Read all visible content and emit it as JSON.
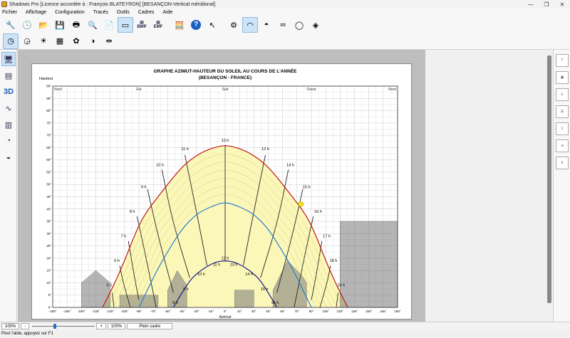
{
  "window": {
    "title": "Shadows Pro  [Licence accordée à :  François BLATEYRON]  [BESANÇON-Vertical méridional]",
    "minimize": "—",
    "restore": "❐",
    "close": "✕"
  },
  "menu": [
    "Fichier",
    "Affichage",
    "Configuration",
    "Tracés",
    "Outils",
    "Cadres",
    "Aide"
  ],
  "toolbar1": {
    "bmp_label": "BMP",
    "emf_label": "EMF"
  },
  "chart_data": {
    "type": "line",
    "title": "GRAPHE AZIMUT-HAUTEUR DU SOLEIL AU COURS DE L'ANNÉE",
    "subtitle": "(BESANÇON - FRANCE)",
    "ylabel": "Hauteur",
    "xlabel": "Azimut",
    "xlim": [
      -180,
      180
    ],
    "ylim": [
      0,
      90
    ],
    "x_ticks": [
      "-180°",
      "-165°",
      "-150°",
      "-135°",
      "-120°",
      "-105°",
      "-90°",
      "-75°",
      "-60°",
      "-45°",
      "-30°",
      "-15°",
      "0°",
      "15°",
      "30°",
      "45°",
      "60°",
      "75°",
      "90°",
      "105°",
      "120°",
      "135°",
      "150°",
      "165°",
      "180°"
    ],
    "y_ticks": [
      "0°",
      "5°",
      "10°",
      "15°",
      "20°",
      "25°",
      "30°",
      "35°",
      "40°",
      "45°",
      "50°",
      "55°",
      "60°",
      "65°",
      "70°",
      "75°",
      "80°",
      "85°",
      "90°"
    ],
    "directions": [
      {
        "label": "Nord",
        "az": -180
      },
      {
        "label": "Est",
        "az": -90
      },
      {
        "label": "Sud",
        "az": 0
      },
      {
        "label": "Ouest",
        "az": 90
      },
      {
        "label": "Nord",
        "az": 180
      }
    ],
    "grid": true,
    "series": [
      {
        "key": "summer",
        "color": "#c01818",
        "points": [
          [
            -128,
            0
          ],
          [
            -115,
            10
          ],
          [
            -104,
            20
          ],
          [
            -96,
            28
          ],
          [
            -88,
            35
          ],
          [
            -80,
            40
          ],
          [
            -72,
            44
          ],
          [
            -62,
            49
          ],
          [
            -52,
            54
          ],
          [
            -40,
            59
          ],
          [
            -25,
            63
          ],
          [
            -12,
            65
          ],
          [
            0,
            66
          ],
          [
            12,
            65
          ],
          [
            25,
            63
          ],
          [
            40,
            59
          ],
          [
            52,
            54
          ],
          [
            62,
            49
          ],
          [
            72,
            44
          ],
          [
            80,
            40
          ],
          [
            88,
            35
          ],
          [
            96,
            28
          ],
          [
            104,
            20
          ],
          [
            115,
            10
          ],
          [
            128,
            0
          ]
        ]
      },
      {
        "key": "equinox",
        "color": "#2a7cd0",
        "points": [
          [
            -90,
            0
          ],
          [
            -80,
            8
          ],
          [
            -70,
            16
          ],
          [
            -58,
            24
          ],
          [
            -45,
            32
          ],
          [
            -30,
            38
          ],
          [
            -15,
            41
          ],
          [
            0,
            43
          ],
          [
            15,
            41
          ],
          [
            30,
            38
          ],
          [
            45,
            32
          ],
          [
            58,
            24
          ],
          [
            70,
            16
          ],
          [
            80,
            8
          ],
          [
            90,
            0
          ]
        ]
      },
      {
        "key": "winter",
        "color": "#1a1a8a",
        "points": [
          [
            -54,
            0
          ],
          [
            -45,
            6
          ],
          [
            -35,
            12
          ],
          [
            -22,
            16
          ],
          [
            -10,
            18.5
          ],
          [
            0,
            19
          ],
          [
            10,
            18.5
          ],
          [
            22,
            16
          ],
          [
            35,
            12
          ],
          [
            45,
            6
          ],
          [
            54,
            0
          ]
        ]
      }
    ],
    "hour_lines": [
      {
        "label": "5 h",
        "points": [
          [
            -116,
            0
          ],
          [
            -118,
            6
          ]
        ]
      },
      {
        "label": "6 h",
        "points": [
          [
            -99,
            0
          ],
          [
            -107,
            11
          ],
          [
            -110,
            17
          ]
        ]
      },
      {
        "label": "7 h",
        "points": [
          [
            -90,
            3
          ],
          [
            -95,
            13
          ],
          [
            -101,
            27
          ]
        ]
      },
      {
        "label": "8 h",
        "points": [
          [
            -72,
            0
          ],
          [
            -83,
            21
          ],
          [
            -92,
            37
          ]
        ]
      },
      {
        "label": "9 h",
        "points": [
          [
            -54,
            6
          ],
          [
            -70,
            29
          ],
          [
            -81,
            48
          ]
        ]
      },
      {
        "label": "10 h",
        "points": [
          [
            -37,
            12
          ],
          [
            -55,
            35
          ],
          [
            -66,
            56
          ]
        ]
      },
      {
        "label": "11 h",
        "points": [
          [
            -19,
            17
          ],
          [
            -30,
            39
          ],
          [
            -42,
            62
          ]
        ]
      },
      {
        "label": "12 h",
        "points": [
          [
            0,
            19
          ],
          [
            0,
            43
          ],
          [
            0,
            66
          ]
        ]
      },
      {
        "label": "13 h",
        "points": [
          [
            19,
            17
          ],
          [
            30,
            39
          ],
          [
            42,
            62
          ]
        ]
      },
      {
        "label": "14 h",
        "points": [
          [
            37,
            12
          ],
          [
            55,
            35
          ],
          [
            66,
            56
          ]
        ]
      },
      {
        "label": "15 h",
        "points": [
          [
            54,
            6
          ],
          [
            70,
            29
          ],
          [
            81,
            48
          ]
        ]
      },
      {
        "label": "16 h",
        "points": [
          [
            72,
            0
          ],
          [
            83,
            21
          ],
          [
            92,
            37
          ]
        ]
      },
      {
        "label": "17 h",
        "points": [
          [
            90,
            3
          ],
          [
            95,
            13
          ],
          [
            101,
            27
          ]
        ]
      },
      {
        "label": "18 h",
        "points": [
          [
            99,
            0
          ],
          [
            107,
            11
          ],
          [
            110,
            17
          ]
        ]
      },
      {
        "label": "19 h",
        "points": [
          [
            116,
            0
          ],
          [
            118,
            6
          ]
        ]
      }
    ],
    "hour_labels": [
      {
        "text": "5 h",
        "az": -121,
        "alt": 8.5
      },
      {
        "text": "6 h",
        "az": -113,
        "alt": 18.5
      },
      {
        "text": "7 h",
        "az": -106,
        "alt": 28.5
      },
      {
        "text": "8 h",
        "az": -97,
        "alt": 38.5
      },
      {
        "text": "9 h",
        "az": -85,
        "alt": 48.5
      },
      {
        "text": "10 h",
        "az": -68,
        "alt": 57.5
      },
      {
        "text": "11 h",
        "az": -42,
        "alt": 64
      },
      {
        "text": "12 h",
        "az": 0,
        "alt": 67.5
      },
      {
        "text": "13 h",
        "az": 42,
        "alt": 64
      },
      {
        "text": "14 h",
        "az": 68,
        "alt": 57.5
      },
      {
        "text": "15 h",
        "az": 85,
        "alt": 48.5
      },
      {
        "text": "16 h",
        "az": 97,
        "alt": 38.5
      },
      {
        "text": "17 h",
        "az": 106,
        "alt": 28.5
      },
      {
        "text": "18 h",
        "az": 113,
        "alt": 18.5
      },
      {
        "text": "19 h",
        "az": 121,
        "alt": 8.5
      },
      {
        "text": "9 h",
        "az": -41,
        "alt": 7
      },
      {
        "text": "10 h",
        "az": -25,
        "alt": 13
      },
      {
        "text": "11 h",
        "az": -9,
        "alt": 17
      },
      {
        "text": "12 h",
        "az": 0,
        "alt": 19.5
      },
      {
        "text": "13 h",
        "az": 9,
        "alt": 17
      },
      {
        "text": "14 h",
        "az": 25,
        "alt": 13
      },
      {
        "text": "15 h",
        "az": 41,
        "alt": 7
      },
      {
        "text": "8 h",
        "az": -52,
        "alt": 1.5
      },
      {
        "text": "16 h",
        "az": 52,
        "alt": 1.5
      }
    ],
    "sun_marker": {
      "az": 79,
      "alt": 42,
      "color": "#f0e020"
    },
    "obstacles": [
      {
        "points": [
          [
            -150,
            10
          ],
          [
            -135,
            15
          ],
          [
            -120,
            10
          ],
          [
            -120,
            0
          ],
          [
            -150,
            0
          ]
        ]
      },
      {
        "points": [
          [
            -110,
            0
          ],
          [
            -110,
            5
          ],
          [
            -70,
            5
          ],
          [
            -70,
            0
          ]
        ]
      },
      {
        "points": [
          [
            -60,
            0
          ],
          [
            -60,
            7
          ],
          [
            -50,
            15
          ],
          [
            -40,
            9
          ],
          [
            -40,
            0
          ]
        ]
      },
      {
        "points": [
          [
            10,
            0
          ],
          [
            10,
            7
          ],
          [
            30,
            7
          ],
          [
            30,
            0
          ]
        ]
      },
      {
        "points": [
          [
            50,
            0
          ],
          [
            50,
            7
          ],
          [
            65,
            19
          ],
          [
            80,
            13
          ],
          [
            85,
            10
          ],
          [
            85,
            0
          ]
        ]
      },
      {
        "points": [
          [
            120,
            0
          ],
          [
            120,
            35
          ],
          [
            180,
            35
          ],
          [
            180,
            0
          ]
        ]
      }
    ]
  },
  "status": {
    "zoom_left": "100%",
    "minus": "-",
    "plus": "+",
    "zoom_right": "100%",
    "fit": "Plein cadre"
  },
  "help": "Pour l'aide, appuyez sur F1"
}
